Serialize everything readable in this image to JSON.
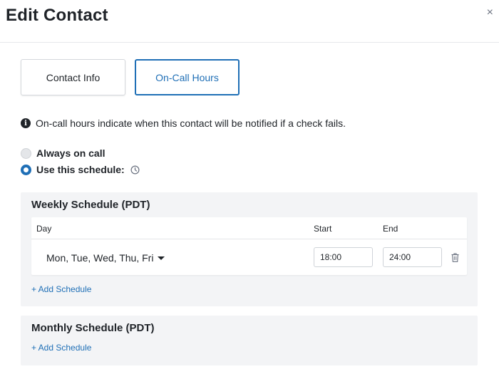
{
  "dialog": {
    "title": "Edit Contact",
    "close_label": "×"
  },
  "tabs": [
    {
      "label": "Contact Info",
      "active": false
    },
    {
      "label": "On-Call Hours",
      "active": true
    }
  ],
  "info": {
    "icon": "info-icon",
    "text": "On-call hours indicate when this contact will be notified if a check fails."
  },
  "on_call_options": [
    {
      "label": "Always on call",
      "selected": false
    },
    {
      "label": "Use this schedule:",
      "selected": true
    }
  ],
  "weekly": {
    "title": "Weekly Schedule (PDT)",
    "columns": {
      "day": "Day",
      "start": "Start",
      "end": "End"
    },
    "rows": [
      {
        "days": "Mon, Tue, Wed, Thu, Fri",
        "start": "18:00",
        "end": "24:00"
      }
    ],
    "add_label": "+ Add Schedule"
  },
  "monthly": {
    "title": "Monthly Schedule (PDT)",
    "add_label": "+ Add Schedule"
  },
  "colors": {
    "accent": "#1f6fb6",
    "panel_bg": "#f3f4f6",
    "text": "#1f2328"
  }
}
